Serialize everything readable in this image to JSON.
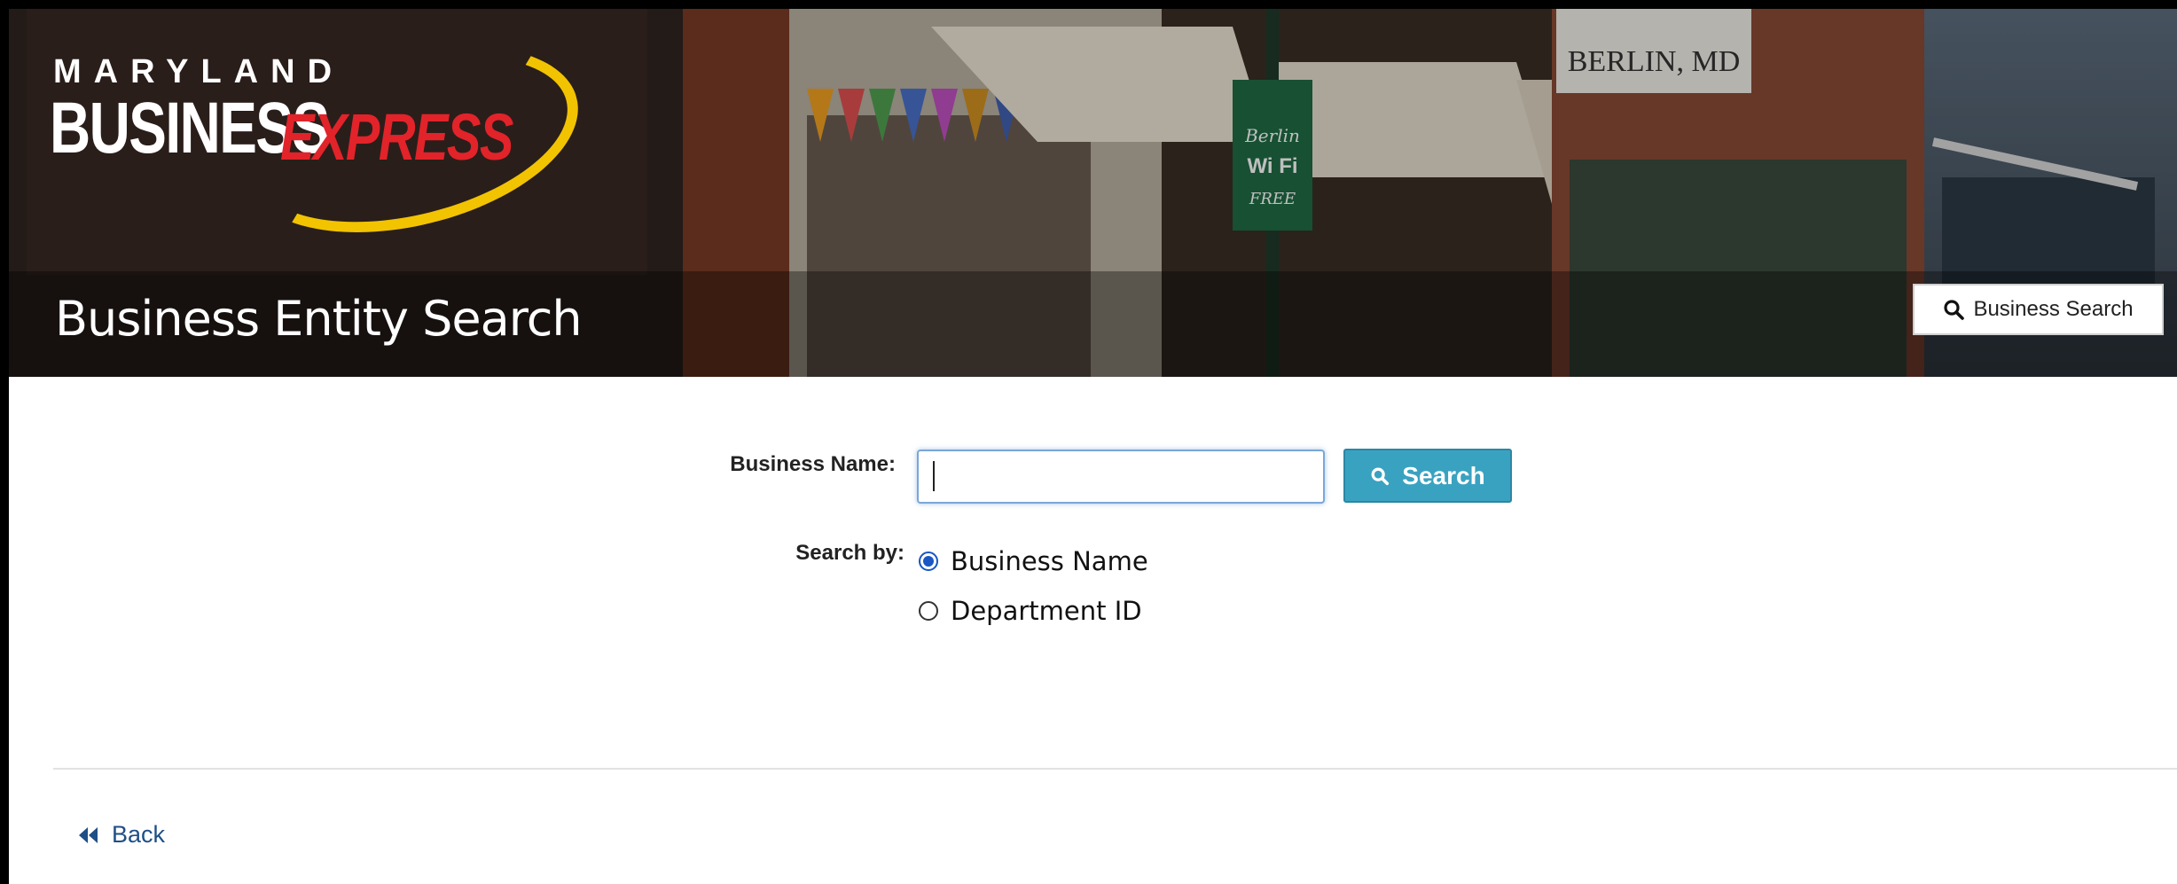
{
  "banner": {
    "logo_state": "MARYLAND",
    "logo_business": "BUSINESS",
    "logo_express": "EXPRESS",
    "page_title": "Business Entity Search",
    "business_search_button": "Business Search",
    "background_signs": [
      "BERLIN, MD",
      "Berlin",
      "Wi Fi",
      "FREE"
    ],
    "icon": "search-icon"
  },
  "form": {
    "business_name_label": "Business Name:",
    "business_name_value": "",
    "search_button": "Search",
    "search_by_label": "Search by:",
    "search_options": [
      {
        "label": "Business Name",
        "selected": true
      },
      {
        "label": "Department ID",
        "selected": false
      }
    ]
  },
  "footer": {
    "back_label": "Back",
    "back_icon": "double-chevron-left-icon"
  },
  "colors": {
    "search_button": "#3aa2c1",
    "logo_express": "#e2232a",
    "logo_ring": "#f2c300",
    "link": "#1f4f86",
    "radio_selected": "#1a56c4"
  }
}
